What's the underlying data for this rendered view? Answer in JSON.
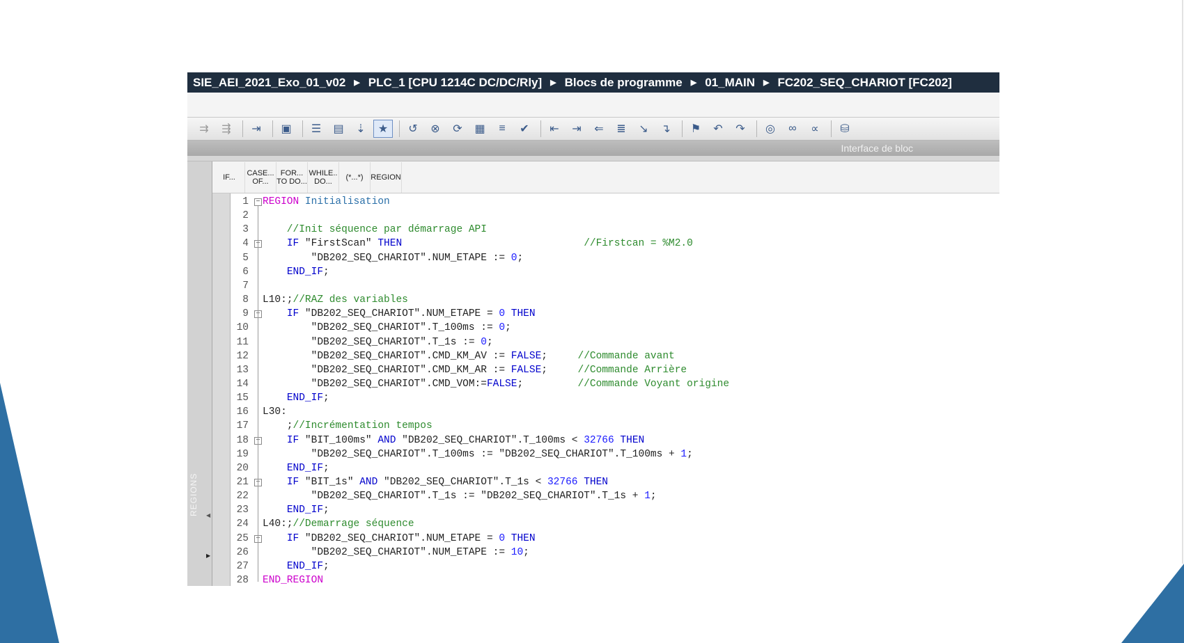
{
  "breadcrumb": {
    "items": [
      "SIE_AEI_2021_Exo_01_v02",
      "PLC_1 [CPU 1214C DC/DC/Rly]",
      "Blocs de programme",
      "01_MAIN",
      "FC202_SEQ_CHARIOT [FC202]"
    ]
  },
  "toolbar": {
    "interface_label": "Interface de bloc"
  },
  "side_panel": {
    "label": "REGIONS"
  },
  "instructions": [
    {
      "label": "IF..."
    },
    {
      "label": "CASE...\nOF..."
    },
    {
      "label": "FOR...\nTO DO..."
    },
    {
      "label": "WHILE..\nDO..."
    },
    {
      "label": "(*...*)"
    },
    {
      "label": "REGION"
    }
  ],
  "colors": {
    "keyword": "#0000cc",
    "region": "#cc00cc",
    "comment": "#2e8b2e",
    "number": "#1a1aff",
    "text": "#222222",
    "breadcrumb_bg": "#1f2e3f",
    "deco_blue": "#2e6fa3"
  },
  "code": [
    {
      "n": "1",
      "tokens": [
        {
          "t": "REGION",
          "c": "rg"
        },
        {
          "t": " Initialisation",
          "c": "rn"
        }
      ]
    },
    {
      "n": "2",
      "tokens": []
    },
    {
      "n": "3",
      "tokens": [
        {
          "t": "    //Init séquence par démarrage API",
          "c": "cm"
        }
      ]
    },
    {
      "n": "4",
      "tokens": [
        {
          "t": "    ",
          "c": "tx"
        },
        {
          "t": "IF",
          "c": "kw"
        },
        {
          "t": " \"FirstScan\" ",
          "c": "tx"
        },
        {
          "t": "THEN",
          "c": "kw"
        },
        {
          "t": "                              ",
          "c": "tx"
        },
        {
          "t": "//Firstcan = %M2.0",
          "c": "cm"
        }
      ]
    },
    {
      "n": "5",
      "tokens": [
        {
          "t": "        \"DB202_SEQ_CHARIOT\".NUM_ETAPE := ",
          "c": "tx"
        },
        {
          "t": "0",
          "c": "nm"
        },
        {
          "t": ";",
          "c": "tx"
        }
      ]
    },
    {
      "n": "6",
      "tokens": [
        {
          "t": "    ",
          "c": "tx"
        },
        {
          "t": "END_IF",
          "c": "kw"
        },
        {
          "t": ";",
          "c": "tx"
        }
      ]
    },
    {
      "n": "7",
      "tokens": []
    },
    {
      "n": "8",
      "tokens": [
        {
          "t": "L10:;",
          "c": "tx"
        },
        {
          "t": "//RAZ des variables",
          "c": "cm"
        }
      ]
    },
    {
      "n": "9",
      "tokens": [
        {
          "t": "    ",
          "c": "tx"
        },
        {
          "t": "IF",
          "c": "kw"
        },
        {
          "t": " \"DB202_SEQ_CHARIOT\".NUM_ETAPE = ",
          "c": "tx"
        },
        {
          "t": "0",
          "c": "nm"
        },
        {
          "t": " ",
          "c": "tx"
        },
        {
          "t": "THEN",
          "c": "kw"
        }
      ]
    },
    {
      "n": "10",
      "tokens": [
        {
          "t": "        \"DB202_SEQ_CHARIOT\".T_100ms := ",
          "c": "tx"
        },
        {
          "t": "0",
          "c": "nm"
        },
        {
          "t": ";",
          "c": "tx"
        }
      ]
    },
    {
      "n": "11",
      "tokens": [
        {
          "t": "        \"DB202_SEQ_CHARIOT\".T_1s := ",
          "c": "tx"
        },
        {
          "t": "0",
          "c": "nm"
        },
        {
          "t": ";",
          "c": "tx"
        }
      ]
    },
    {
      "n": "12",
      "tokens": [
        {
          "t": "        \"DB202_SEQ_CHARIOT\".CMD_KM_AV := ",
          "c": "tx"
        },
        {
          "t": "FALSE",
          "c": "kw"
        },
        {
          "t": ";     ",
          "c": "tx"
        },
        {
          "t": "//Commande avant",
          "c": "cm"
        }
      ]
    },
    {
      "n": "13",
      "tokens": [
        {
          "t": "        \"DB202_SEQ_CHARIOT\".CMD_KM_AR := ",
          "c": "tx"
        },
        {
          "t": "FALSE",
          "c": "kw"
        },
        {
          "t": ";     ",
          "c": "tx"
        },
        {
          "t": "//Commande Arrière",
          "c": "cm"
        }
      ]
    },
    {
      "n": "14",
      "tokens": [
        {
          "t": "        \"DB202_SEQ_CHARIOT\".CMD_VOM:=",
          "c": "tx"
        },
        {
          "t": "FALSE",
          "c": "kw"
        },
        {
          "t": ";         ",
          "c": "tx"
        },
        {
          "t": "//Commande Voyant origine",
          "c": "cm"
        }
      ]
    },
    {
      "n": "15",
      "tokens": [
        {
          "t": "    ",
          "c": "tx"
        },
        {
          "t": "END_IF",
          "c": "kw"
        },
        {
          "t": ";",
          "c": "tx"
        }
      ]
    },
    {
      "n": "16",
      "tokens": [
        {
          "t": "L30:",
          "c": "tx"
        }
      ]
    },
    {
      "n": "17",
      "tokens": [
        {
          "t": "    ;",
          "c": "tx"
        },
        {
          "t": "//Incrémentation tempos",
          "c": "cm"
        }
      ]
    },
    {
      "n": "18",
      "tokens": [
        {
          "t": "    ",
          "c": "tx"
        },
        {
          "t": "IF",
          "c": "kw"
        },
        {
          "t": " \"BIT_100ms\" ",
          "c": "tx"
        },
        {
          "t": "AND",
          "c": "kw"
        },
        {
          "t": " \"DB202_SEQ_CHARIOT\".T_100ms < ",
          "c": "tx"
        },
        {
          "t": "32766",
          "c": "nm"
        },
        {
          "t": " ",
          "c": "tx"
        },
        {
          "t": "THEN",
          "c": "kw"
        }
      ]
    },
    {
      "n": "19",
      "tokens": [
        {
          "t": "        \"DB202_SEQ_CHARIOT\".T_100ms := \"DB202_SEQ_CHARIOT\".T_100ms + ",
          "c": "tx"
        },
        {
          "t": "1",
          "c": "nm"
        },
        {
          "t": ";",
          "c": "tx"
        }
      ]
    },
    {
      "n": "20",
      "tokens": [
        {
          "t": "    ",
          "c": "tx"
        },
        {
          "t": "END_IF",
          "c": "kw"
        },
        {
          "t": ";",
          "c": "tx"
        }
      ]
    },
    {
      "n": "21",
      "tokens": [
        {
          "t": "    ",
          "c": "tx"
        },
        {
          "t": "IF",
          "c": "kw"
        },
        {
          "t": " \"BIT_1s\" ",
          "c": "tx"
        },
        {
          "t": "AND",
          "c": "kw"
        },
        {
          "t": " \"DB202_SEQ_CHARIOT\".T_1s < ",
          "c": "tx"
        },
        {
          "t": "32766",
          "c": "nm"
        },
        {
          "t": " ",
          "c": "tx"
        },
        {
          "t": "THEN",
          "c": "kw"
        }
      ]
    },
    {
      "n": "22",
      "tokens": [
        {
          "t": "        \"DB202_SEQ_CHARIOT\".T_1s := \"DB202_SEQ_CHARIOT\".T_1s + ",
          "c": "tx"
        },
        {
          "t": "1",
          "c": "nm"
        },
        {
          "t": ";",
          "c": "tx"
        }
      ]
    },
    {
      "n": "23",
      "tokens": [
        {
          "t": "    ",
          "c": "tx"
        },
        {
          "t": "END_IF",
          "c": "kw"
        },
        {
          "t": ";",
          "c": "tx"
        }
      ]
    },
    {
      "n": "24",
      "tokens": [
        {
          "t": "L40:;",
          "c": "tx"
        },
        {
          "t": "//Demarrage séquence",
          "c": "cm"
        }
      ]
    },
    {
      "n": "25",
      "tokens": [
        {
          "t": "    ",
          "c": "tx"
        },
        {
          "t": "IF",
          "c": "kw"
        },
        {
          "t": " \"DB202_SEQ_CHARIOT\".NUM_ETAPE = ",
          "c": "tx"
        },
        {
          "t": "0",
          "c": "nm"
        },
        {
          "t": " ",
          "c": "tx"
        },
        {
          "t": "THEN",
          "c": "kw"
        }
      ]
    },
    {
      "n": "26",
      "tokens": [
        {
          "t": "        \"DB202_SEQ_CHARIOT\".NUM_ETAPE := ",
          "c": "tx"
        },
        {
          "t": "10",
          "c": "nm"
        },
        {
          "t": ";",
          "c": "tx"
        }
      ]
    },
    {
      "n": "27",
      "tokens": [
        {
          "t": "    ",
          "c": "tx"
        },
        {
          "t": "END_IF",
          "c": "kw"
        },
        {
          "t": ";",
          "c": "tx"
        }
      ]
    },
    {
      "n": "28",
      "tokens": [
        {
          "t": "END_REGION",
          "c": "rg"
        }
      ]
    }
  ],
  "fold_lines": [
    "1",
    "4",
    "9",
    "18",
    "21",
    "25"
  ],
  "toolbar_icons": [
    "insert-network-icon",
    "remove-network-icon",
    "sep",
    "download-icon",
    "sep",
    "monitor-icon",
    "sep",
    "indent-icon",
    "compile-icon",
    "load-icon",
    "favorite-icon",
    "sep",
    "reset-icon",
    "delete-call-icon",
    "update-call-icon",
    "open-block-icon",
    "list-icon",
    "check-icon",
    "sep",
    "decrease-indent-icon",
    "increase-indent-icon",
    "outdent-icon",
    "format-icon",
    "jump-icon",
    "goto-icon",
    "sep",
    "bookmark-icon",
    "prev-bookmark-icon",
    "next-bookmark-icon",
    "sep",
    "observe-icon",
    "glasses-icon",
    "glasses-off-icon",
    "sep",
    "database-icon"
  ]
}
